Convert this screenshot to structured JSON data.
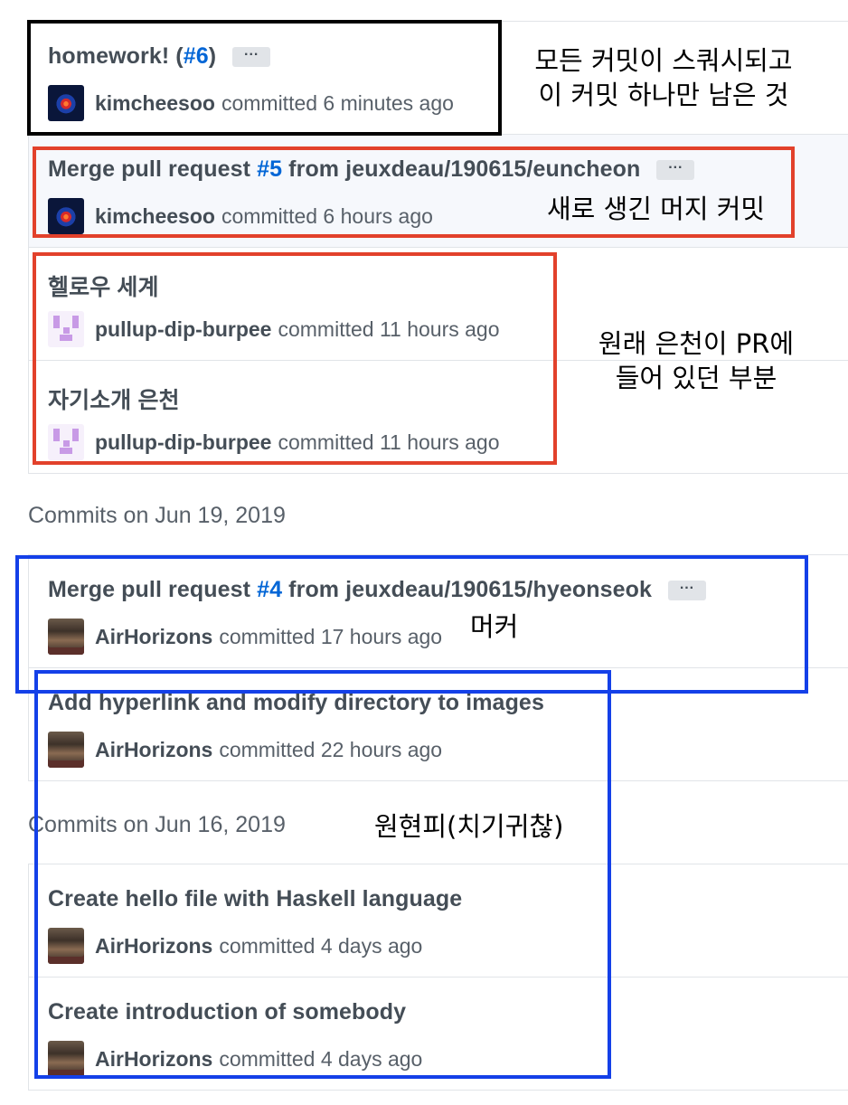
{
  "groups": [
    {
      "commits": [
        {
          "title": "homework! (",
          "pr": "#6",
          "title_end": ")",
          "author": "kimcheesoo",
          "time": "committed 6 minutes ago",
          "dots": "···"
        },
        {
          "title": "Merge pull request ",
          "pr": "#5",
          "title_end": " from jeuxdeau/190615/euncheon",
          "author": "kimcheesoo",
          "time": "committed 6 hours ago",
          "dots": "···"
        },
        {
          "title": "헬로우 세계",
          "author": "pullup-dip-burpee",
          "time": "committed 11 hours ago"
        },
        {
          "title": "자기소개 은천",
          "author": "pullup-dip-burpee",
          "time": "committed 11 hours ago"
        }
      ]
    },
    {
      "date": "Commits on Jun 19, 2019",
      "commits": [
        {
          "title": "Merge pull request ",
          "pr": "#4",
          "title_end": " from jeuxdeau/190615/hyeonseok",
          "author": "AirHorizons",
          "time": "committed 17 hours ago",
          "dots": "···"
        },
        {
          "title": "Add hyperlink and modify directory to images",
          "author": "AirHorizons",
          "time": "committed 22 hours ago"
        }
      ]
    },
    {
      "date": "Commits on Jun 16, 2019",
      "commits": [
        {
          "title": "Create hello file with Haskell language",
          "author": "AirHorizons",
          "time": "committed 4 days ago"
        },
        {
          "title": "Create introduction of somebody",
          "author": "AirHorizons",
          "time": "committed 4 days ago"
        }
      ]
    }
  ],
  "annotations": {
    "squash_line1": "모든 커밋이 스쿼시되고",
    "squash_line2": "이 커밋 하나만 남은 것",
    "new_merge": "새로 생긴 머지 커밋",
    "orig_line1": "원래 은천이 PR에",
    "orig_line2": "들어 있던 부분",
    "merger": "머커",
    "original": "원현피(치기귀찮)"
  },
  "colors": {
    "black_box": "#000000",
    "red_box": "#e2412b",
    "blue_box": "#1440e8",
    "link": "#0366d6"
  }
}
